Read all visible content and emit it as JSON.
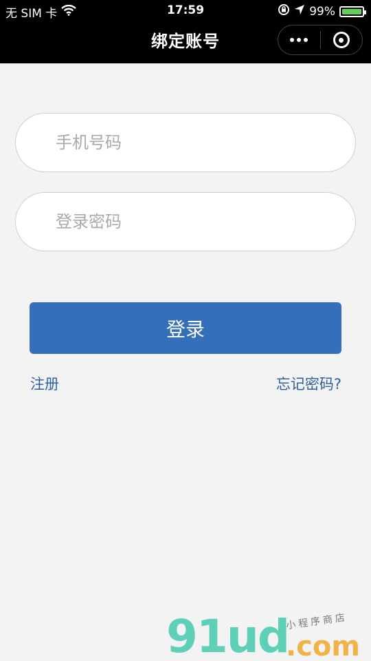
{
  "status_bar": {
    "carrier": "无 SIM 卡",
    "time": "17:59",
    "battery_percent": "99%",
    "battery_level": 0.99,
    "icons": [
      "wifi-icon",
      "lock-rotation-icon",
      "location-icon",
      "battery-icon"
    ]
  },
  "nav": {
    "title": "绑定账号",
    "capsule": {
      "more_icon": "more-dots-icon",
      "close_icon": "target-circle-icon"
    }
  },
  "form": {
    "phone_placeholder": "手机号码",
    "password_placeholder": "登录密码",
    "login_label": "登录",
    "register_label": "注册",
    "forgot_label": "忘记密码?"
  },
  "colors": {
    "primary_button": "#356fb9",
    "link": "#2e5fa0",
    "background": "#f3f3f3",
    "topbar": "#000000"
  },
  "watermark": {
    "main": "91ud",
    "domain": ".com",
    "subtitle": "小程序商店"
  }
}
